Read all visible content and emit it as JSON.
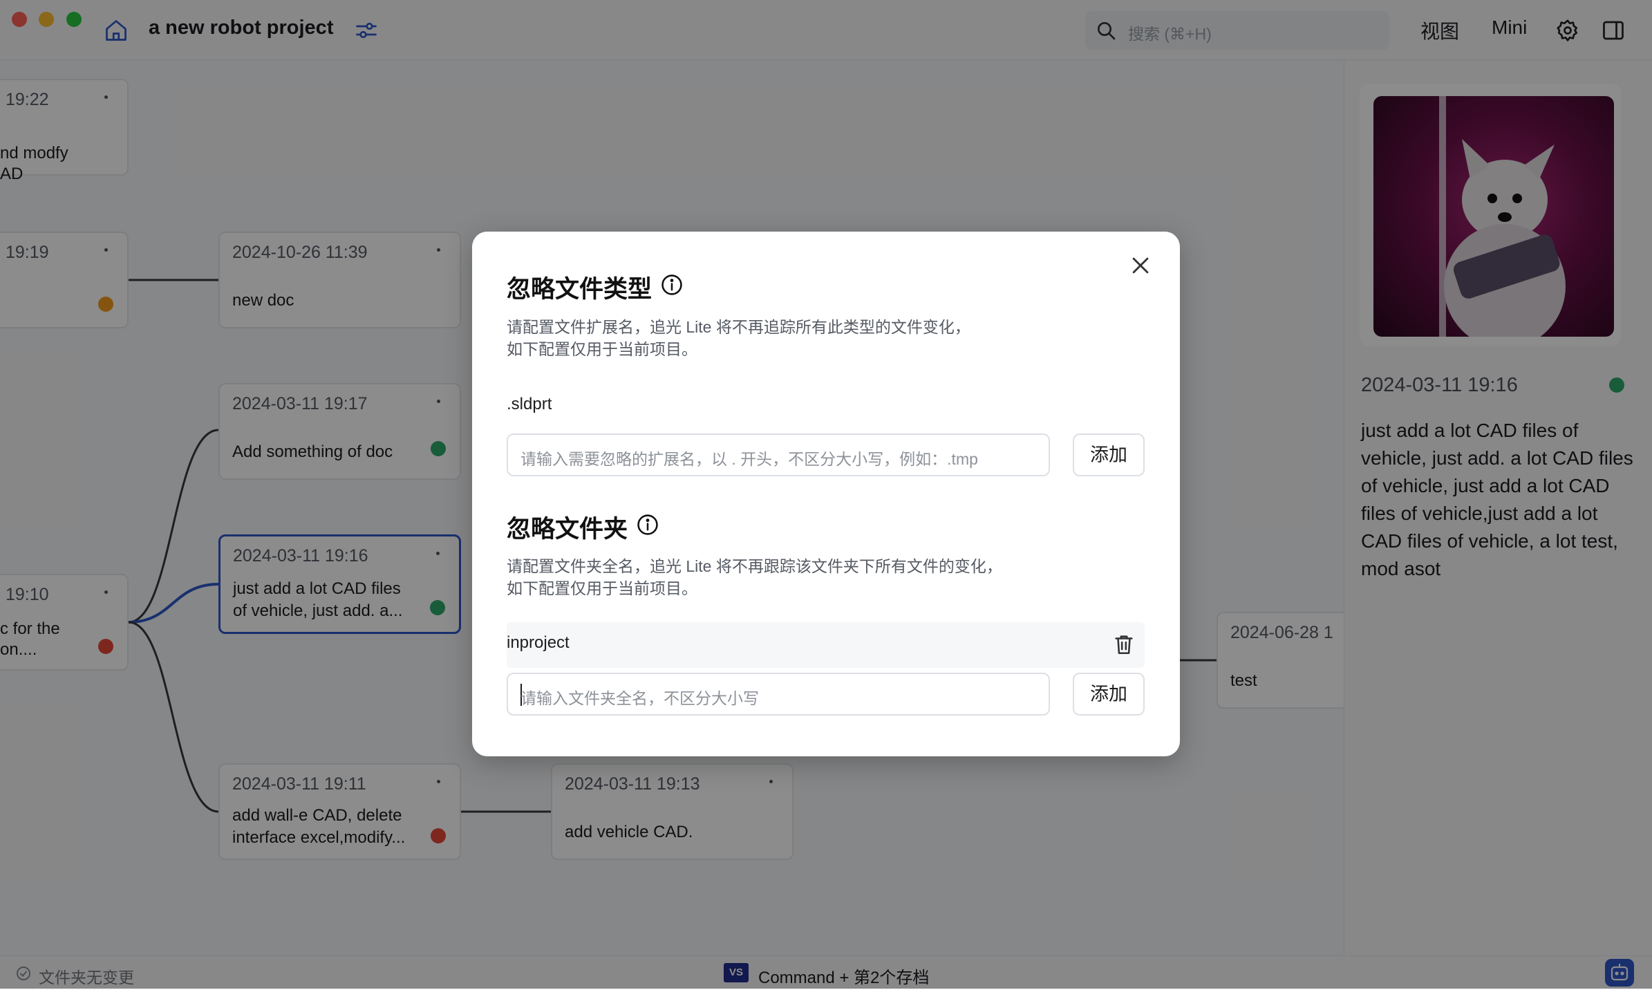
{
  "titlebar": {
    "project_title": "a new robot project",
    "search_placeholder": "搜索 (⌘+H)",
    "view_label": "视图",
    "mini_label": "Mini"
  },
  "nodes": [
    {
      "time": "19:22",
      "line1": "nd modfy",
      "line2": "AD",
      "status": null
    },
    {
      "time": "19:19",
      "line1": "",
      "line2": "",
      "status": "orange"
    },
    {
      "time": "19:10",
      "line1": "c for the",
      "line2": "on....",
      "status": "red"
    },
    {
      "time": "2024-10-26 11:39",
      "line1": "new doc",
      "line2": "",
      "status": null
    },
    {
      "time": "2024-03-11 19:17",
      "line1": "Add something of doc",
      "line2": "",
      "status": "green"
    },
    {
      "time": "2024-03-11 19:16",
      "line1": "just add a lot CAD files",
      "line2": "of vehicle, just add. a...",
      "status": "green"
    },
    {
      "time": "2024-03-11 19:11",
      "line1": "add wall-e CAD, delete",
      "line2": "interface excel,modify...",
      "status": "red"
    },
    {
      "time": "2024-03-11 19:13",
      "line1": "add vehicle CAD.",
      "line2": "",
      "status": null
    },
    {
      "time": "2024-06-28 1",
      "line1": "test",
      "line2": "",
      "status": null
    }
  ],
  "detail": {
    "time": "2024-03-11 19:16",
    "description": "just add a lot CAD files of vehicle, just add. a lot CAD files of vehicle, just add a lot CAD files of vehicle,just add a lot CAD files of vehicle, a lot test, mod asot"
  },
  "statusbar": {
    "left_text": "文件夹无变更",
    "vs_badge": "VS",
    "center_text": "Command + 第2个存档"
  },
  "modal": {
    "filetype_title": "忽略文件类型",
    "filetype_desc_line1": "请配置文件扩展名，追光 Lite 将不再追踪所有此类型的文件变化，",
    "filetype_desc_line2": "如下配置仅用于当前项目。",
    "filetype_items": [
      ".sldprt"
    ],
    "filetype_placeholder": "请输入需要忽略的扩展名，以 . 开头，不区分大小写，例如：.tmp",
    "add_label": "添加",
    "folder_title": "忽略文件夹",
    "folder_desc_line1": "请配置文件夹全名，追光 Lite 将不再跟踪该文件夹下所有文件的变化，",
    "folder_desc_line2": "如下配置仅用于当前项目。",
    "folder_items": [
      "inproject"
    ],
    "folder_placeholder": "请输入文件夹全名，不区分大小写"
  },
  "colors": {
    "accent": "#2f56c9",
    "status_green": "#2ea86b",
    "status_red": "#e5483a",
    "status_orange": "#f39b1c"
  }
}
